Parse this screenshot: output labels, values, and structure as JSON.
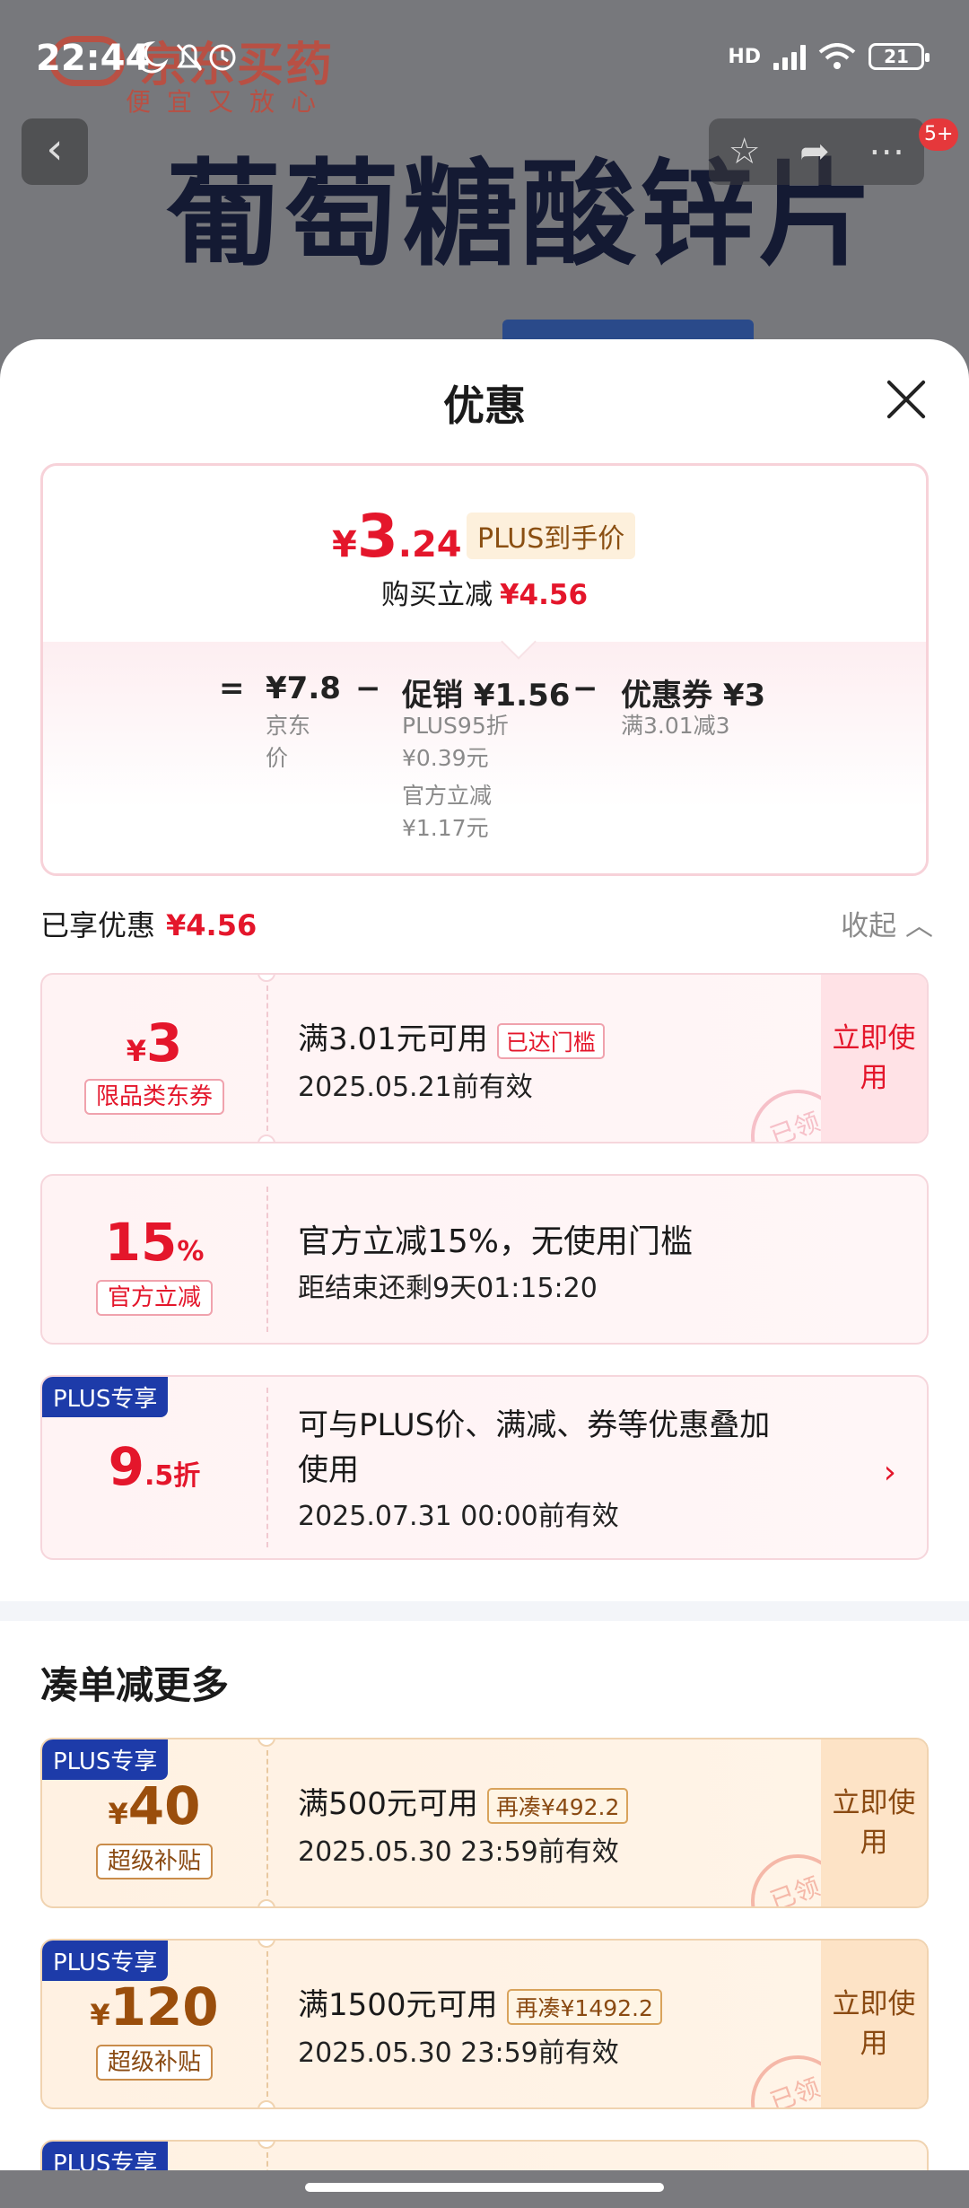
{
  "status_bar": {
    "time": "22:44",
    "network": "HD",
    "battery": "21"
  },
  "background": {
    "store_name": "京东买药",
    "store_slogan": "便宜又放心",
    "product_title": "葡萄糖酸锌片",
    "badge": "5+",
    "icons": [
      "back-icon",
      "star-icon",
      "share-icon",
      "more-icon"
    ]
  },
  "sheet": {
    "title": "优惠",
    "price": {
      "currency": "¥",
      "integer": "3",
      "decimal": ".24",
      "tag": "PLUS到手价",
      "reduce_label": "购买立减",
      "reduce_amount": "¥4.56"
    },
    "calc": {
      "equals": "=",
      "minus": "−",
      "base_price": "¥7.8",
      "base_label_1": "京东",
      "base_label_2": "价",
      "promo": "促销 ¥1.56",
      "promo_line1": "PLUS95折",
      "promo_line2": "¥0.39元",
      "promo_line3": "官方立减",
      "promo_line4": "¥1.17元",
      "coupon": "优惠券 ¥3",
      "coupon_sub": "满3.01减3"
    },
    "enjoyed": {
      "label": "已享优惠",
      "amount": "¥4.56",
      "collapse": "收起"
    },
    "coupons": [
      {
        "cur": "¥",
        "amount": "3",
        "tag": "限品类东券",
        "main": "满3.01元可用",
        "badge": "已达门槛",
        "sub": "2025.05.21前有效",
        "action": "立即使用",
        "stamp": "已领"
      },
      {
        "amount": "15",
        "unit": "%",
        "tag": "官方立减",
        "main": "官方立减15%，无使用门槛",
        "sub": "距结束还剩9天01:15:20"
      },
      {
        "plus": "PLUS专享",
        "amount": "9",
        "unit": ".5折",
        "main_line1": "可与PLUS价、满减、券等优惠叠加",
        "main_line2": "使用",
        "sub": "2025.07.31 00:00前有效"
      }
    ],
    "section_title": "凑单减更多",
    "more_coupons": [
      {
        "plus": "PLUS专享",
        "cur": "¥",
        "amount": "40",
        "tag": "超级补贴",
        "main": "满500元可用",
        "badge": "再凑¥492.2",
        "sub": "2025.05.30 23:59前有效",
        "action": "立即使用",
        "stamp": "已领"
      },
      {
        "plus": "PLUS专享",
        "cur": "¥",
        "amount": "120",
        "tag": "超级补贴",
        "main": "满1500元可用",
        "badge": "再凑¥1492.2",
        "sub": "2025.05.30 23:59前有效",
        "action": "立即使用",
        "stamp": "已领"
      },
      {
        "plus": "PLUS专享"
      }
    ]
  },
  "colors": {
    "accent_red": "#e4162b",
    "plus_blue": "#1d3ba9",
    "gold_text": "#9a4e0c"
  }
}
